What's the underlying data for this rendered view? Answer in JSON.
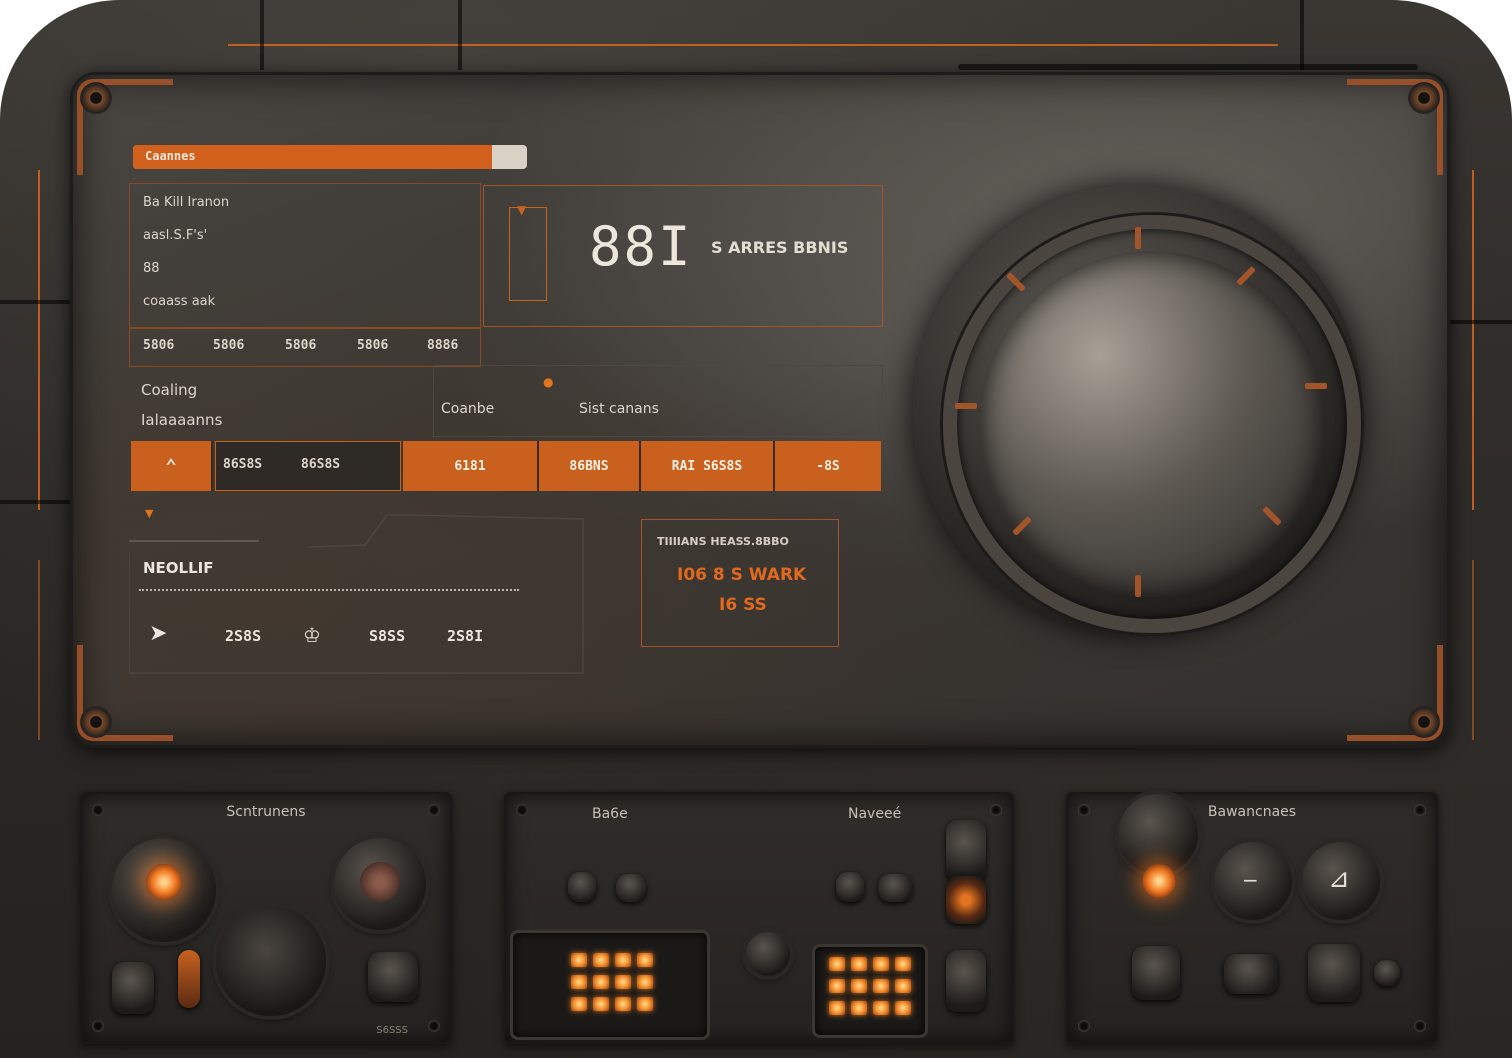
{
  "colors": {
    "accent": "#c8621f",
    "accent_bright": "#d8661f",
    "panel_dark": "#2b2926",
    "text_light": "#ddd6cc"
  },
  "top_progress": {
    "label": "Caannes",
    "fraction": 0.91
  },
  "info_list": {
    "lines": [
      "Ba Kill Iranon",
      "aasl.S.F's'",
      "88",
      "coaass aak"
    ]
  },
  "info_footer": {
    "cells": [
      "5806",
      "5806",
      "5806",
      "5806",
      "8886"
    ]
  },
  "readout": {
    "value": "88I",
    "status": "S ARRES BBNIS"
  },
  "section_labels": {
    "left_top": "Coaling",
    "left_bottom": "Ialaaaanns",
    "center_a": "Coanbe",
    "center_b": "Sist canans"
  },
  "action_strip": {
    "up_icon": "chevron-up-icon",
    "field_a": "86S8S",
    "field_b": "86S8S",
    "buttons": [
      "6181",
      "86BNS",
      "RAI S6S8S",
      "-8S"
    ]
  },
  "lower_panel": {
    "title": "NEOLLIF",
    "items": [
      {
        "icon": "arrow-icon",
        "label": ""
      },
      {
        "icon": "",
        "label": "2S8S"
      },
      {
        "icon": "crown-icon",
        "label": ""
      },
      {
        "icon": "",
        "label": "S8SS"
      },
      {
        "icon": "",
        "label": "2S8I"
      }
    ]
  },
  "alert_box": {
    "header": "TIIIIANS HEASS.8BBO",
    "line1": "I06 8 S WARK",
    "line2": "I6 SS"
  },
  "control_panels": [
    {
      "title": "Scntrunens",
      "footer": "S6SSS"
    },
    {
      "title_left": "Ba6e",
      "title_right": "Naveeé"
    },
    {
      "title": "Bawancnaes"
    }
  ]
}
